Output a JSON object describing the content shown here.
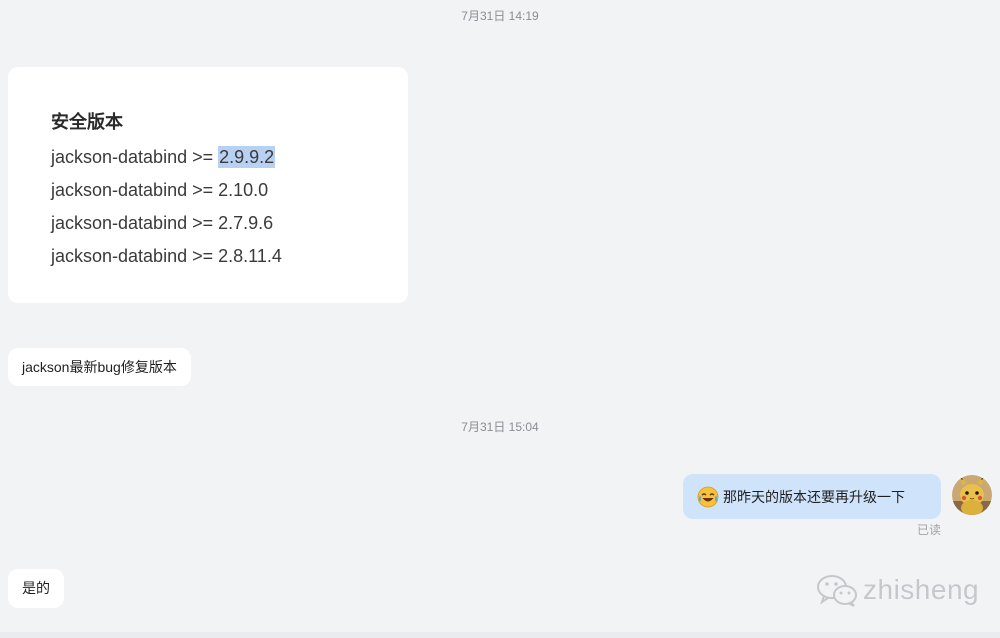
{
  "timestamps": {
    "first": "7月31日 14:19",
    "second": "7月31日 15:04"
  },
  "image_card": {
    "title": "安全版本",
    "lines": [
      {
        "prefix": "jackson-databind >= ",
        "version": "2.9.9.2",
        "selected": true
      },
      {
        "prefix": "jackson-databind >= ",
        "version": "2.10.0",
        "selected": false
      },
      {
        "prefix": "jackson-databind >= ",
        "version": "2.7.9.6",
        "selected": false
      },
      {
        "prefix": "jackson-databind >= ",
        "version": "2.8.11.4",
        "selected": false
      }
    ]
  },
  "messages": {
    "incoming_1": "jackson最新bug修复版本",
    "outgoing_1": "那昨天的版本还要再升级一下",
    "outgoing_1_status": "已读",
    "incoming_2": "是的"
  },
  "icons": {
    "outgoing_emoji": "laughing-crying-emoji-icon",
    "avatar": "pikachu-avatar"
  },
  "watermark": {
    "text": "zhisheng"
  },
  "colors": {
    "background": "#f2f3f5",
    "incoming_bubble": "#ffffff",
    "outgoing_bubble": "#cfe3fb",
    "selection": "#b8d1f3"
  }
}
